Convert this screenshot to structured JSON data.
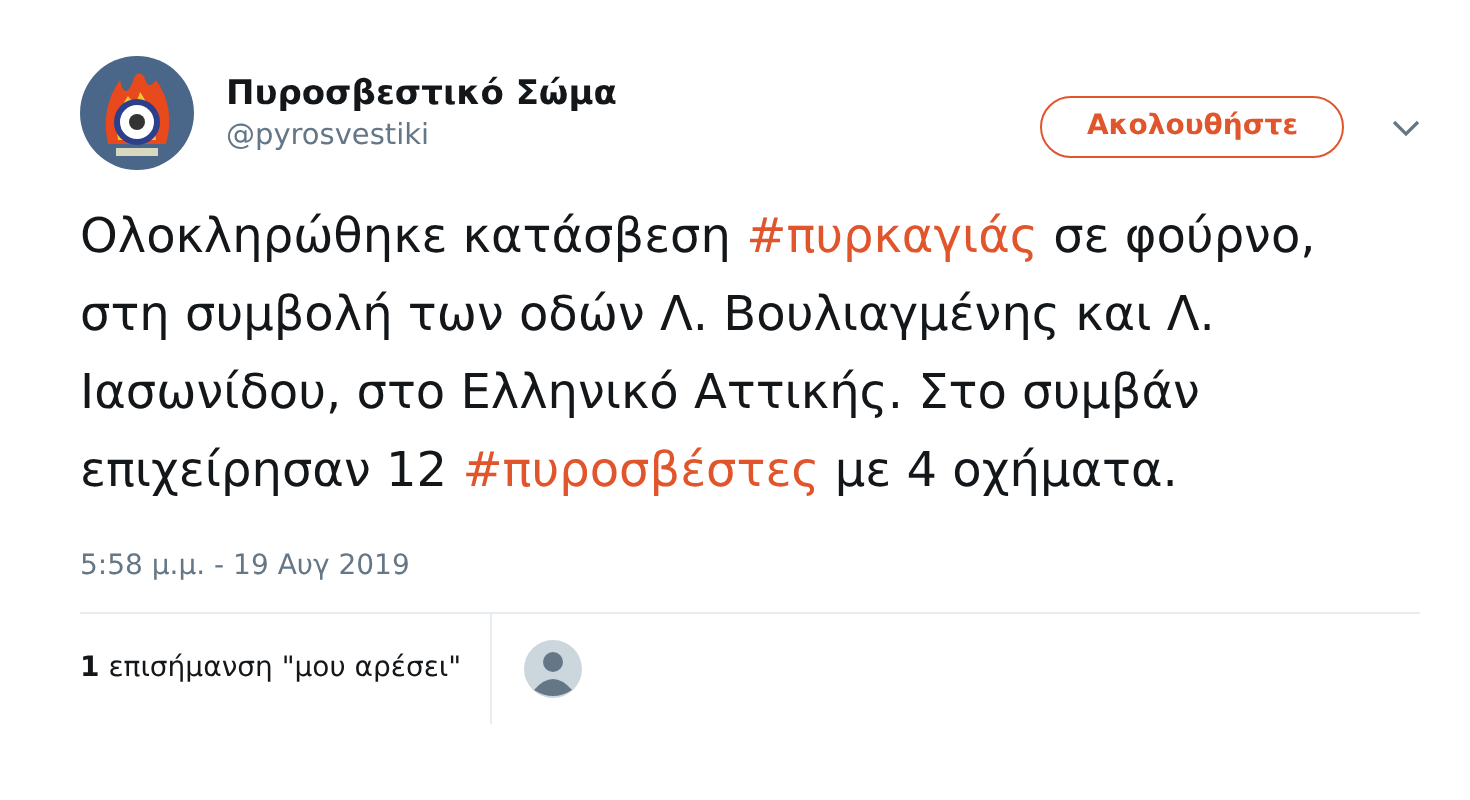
{
  "author": {
    "name": "Πυροσβεστικό Σώμα",
    "handle": "@pyrosvestiki"
  },
  "follow_button": "Ακολουθήστε",
  "tweet": [
    {
      "kind": "text",
      "text": "Ολοκληρώθηκε κατάσβεση "
    },
    {
      "kind": "hashtag",
      "text": "#πυρκαγιάς"
    },
    {
      "kind": "text",
      "text": " σε φούρνο, στη συμβολή των οδών Λ. Βουλιαγμένης και Λ. Ιασωνίδου, στο Ελληνικό Αττικής. Στο συμβάν επιχείρησαν 12 "
    },
    {
      "kind": "hashtag",
      "text": "#πυροσβέστες"
    },
    {
      "kind": "text",
      "text": " με 4 οχήματα."
    }
  ],
  "timestamp": "5:58 μ.μ. - 19 Αυγ 2019",
  "likes": "**1** επισήμανση \"μου αρέσει\""
}
